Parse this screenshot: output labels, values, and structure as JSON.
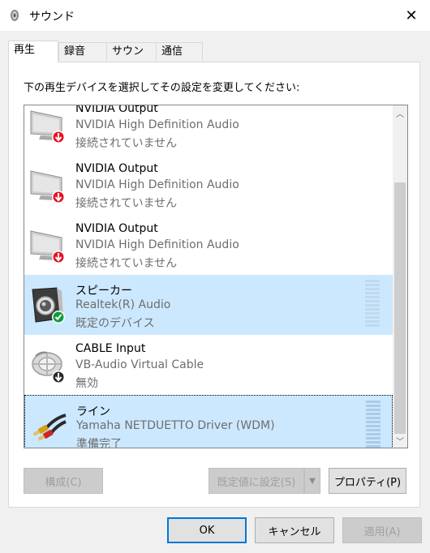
{
  "window": {
    "title": "サウンド",
    "close_glyph": "✕"
  },
  "tabs": [
    {
      "label": "再生",
      "active": true
    },
    {
      "label": "録音",
      "active": false
    },
    {
      "label": "サウンド",
      "active": false
    },
    {
      "label": "通信",
      "active": false
    }
  ],
  "instruction": "下の再生デバイスを選択してその設定を変更してください:",
  "devices": [
    {
      "name": "NVIDIA Output",
      "driver": "NVIDIA High Definition Audio",
      "status": "接続されていません",
      "icon": "monitor-disconnected-icon"
    },
    {
      "name": "NVIDIA Output",
      "driver": "NVIDIA High Definition Audio",
      "status": "接続されていません",
      "icon": "monitor-disconnected-icon"
    },
    {
      "name": "NVIDIA Output",
      "driver": "NVIDIA High Definition Audio",
      "status": "接続されていません",
      "icon": "monitor-disconnected-icon"
    },
    {
      "name": "スピーカー",
      "driver": "Realtek(R) Audio",
      "status": "既定のデバイス",
      "icon": "speaker-default-icon"
    },
    {
      "name": "CABLE Input",
      "driver": "VB-Audio Virtual Cable",
      "status": "無効",
      "icon": "cable-disabled-icon"
    },
    {
      "name": "ライン",
      "driver": "Yamaha NETDUETTO Driver (WDM)",
      "status": "準備完了",
      "icon": "rca-cable-icon"
    }
  ],
  "buttons": {
    "configure": "構成(C)",
    "set_default": "既定値に設定(S)",
    "properties": "プロパティ(P)",
    "ok": "OK",
    "cancel": "キャンセル",
    "apply": "適用(A)"
  },
  "colors": {
    "selection": "#cce8ff",
    "accent": "#0078d7",
    "error_red": "#e81123",
    "success_green": "#0f9d3a"
  }
}
